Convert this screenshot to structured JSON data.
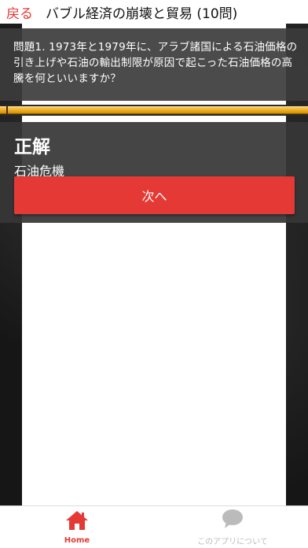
{
  "header": {
    "back_label": "戻る",
    "title": "バブル経済の崩壊と貿易 (10問)"
  },
  "question": {
    "text": "問題1. 1973年と1979年に、アラブ諸国による石油価格の引き上げや石油の輸出制限が原因で起こった石油価格の高騰を何といいますか？"
  },
  "progress": {
    "fraction": 1.0
  },
  "result": {
    "label": "正解",
    "answer": "石油危機",
    "next_label": "次へ"
  },
  "bottom_nav": {
    "items": [
      {
        "label": "Home",
        "icon": "home-icon",
        "active": true
      },
      {
        "label": "このアプリについて",
        "icon": "chat-bubble-icon",
        "active": false
      }
    ]
  },
  "colors": {
    "accent": "#e53935",
    "progress_top": "#ffcf55",
    "progress_bottom": "#d68d00",
    "overlay": "#3c3c3c",
    "inactive": "#bbbbbb"
  }
}
